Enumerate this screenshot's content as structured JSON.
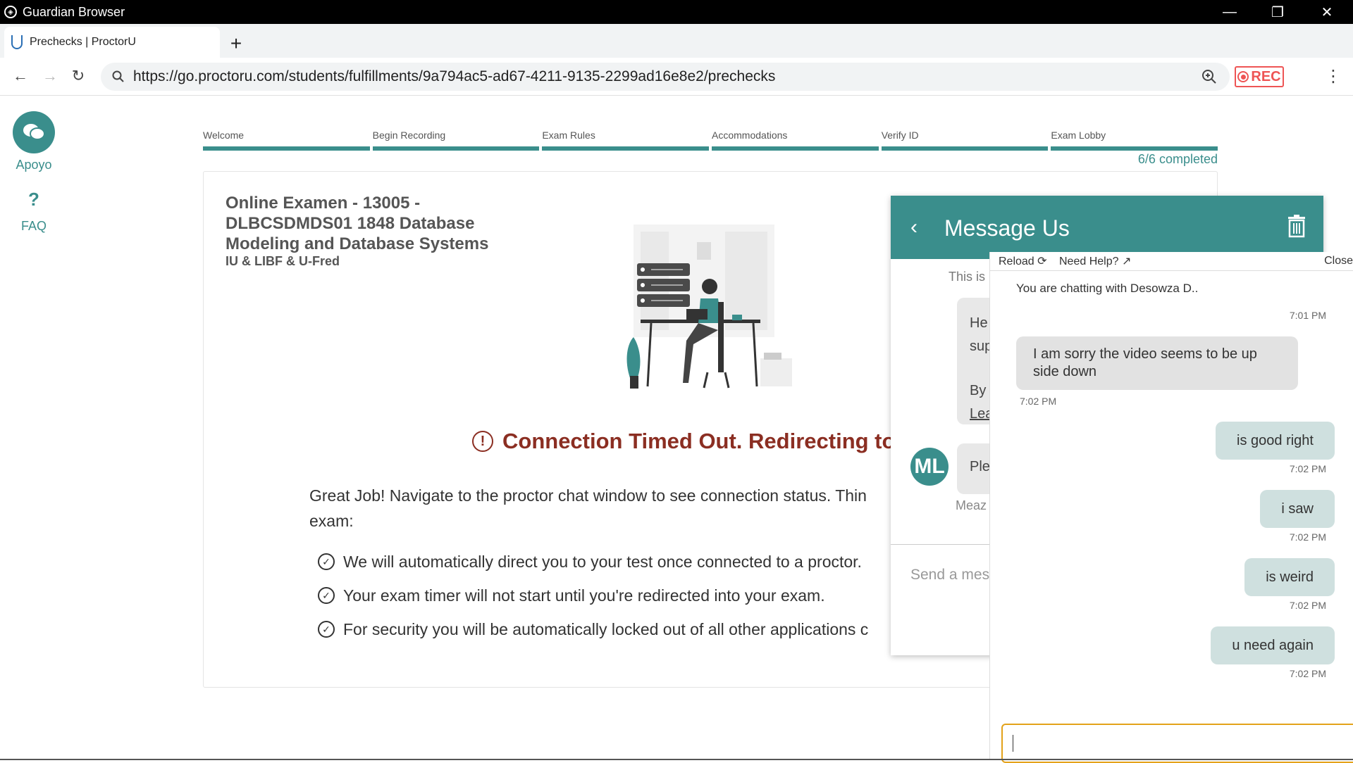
{
  "window": {
    "title": "Guardian Browser"
  },
  "tab": {
    "label": "Prechecks | ProctorU",
    "new_tab": "+"
  },
  "address": {
    "url": "https://go.proctoru.com/students/fulfillments/9a794ac5-ad67-4211-9135-2299ad16e8e2/prechecks",
    "rec_label": "REC"
  },
  "sidebar": {
    "support_label": "Apoyo",
    "faq_icon": "?",
    "faq_label": "FAQ"
  },
  "steps": {
    "items": [
      "Welcome",
      "Begin Recording",
      "Exam Rules",
      "Accommodations",
      "Verify ID",
      "Exam Lobby"
    ],
    "completed": "6/6 completed"
  },
  "exam": {
    "title": "Online Examen - 13005 - DLBCSDMDS01 1848 Database Modeling and Database Systems",
    "subtitle": "IU & LIBF & U-Fred",
    "timeout": "Connection Timed Out. Redirecting to Su",
    "description_line1": "Great Job! Navigate to the proctor chat window to see connection status. Thin",
    "description_line2": "exam:",
    "bullets": [
      "We will automatically direct you to your test once connected to a proctor.",
      "Your exam timer will not start until you're redirected into your exam.",
      "For security you will be automatically locked out of all other applications c"
    ]
  },
  "message_panel": {
    "title": "Message Us",
    "this_is": "This is",
    "bubble1_l1": "He",
    "bubble1_l2": "sup",
    "bubble1_l3": "By",
    "bubble1_l4": "Lea",
    "bubble2": "Ple",
    "avatar_initials": "ML",
    "sender_partial": "Meaz",
    "send_placeholder": "Send a mes"
  },
  "chat": {
    "reload": "Reload",
    "need_help": "Need Help?",
    "close": "Close",
    "chatting_with": "You are chatting with Desowza D..",
    "messages": [
      {
        "text": "7:01 PM"
      },
      {
        "text": "I am sorry the video seems to be up side down",
        "time": "7:02 PM"
      },
      {
        "text": "is good right",
        "time": "7:02 PM"
      },
      {
        "text": "i saw",
        "time": "7:02 PM"
      },
      {
        "text": "is weird",
        "time": "7:02 PM"
      },
      {
        "text": "u need again",
        "time": "7:02 PM"
      }
    ]
  },
  "colors": {
    "teal": "#3a8e8c",
    "error": "#8b2e22",
    "rec": "#e55555",
    "input_focus": "#e3a21a"
  }
}
